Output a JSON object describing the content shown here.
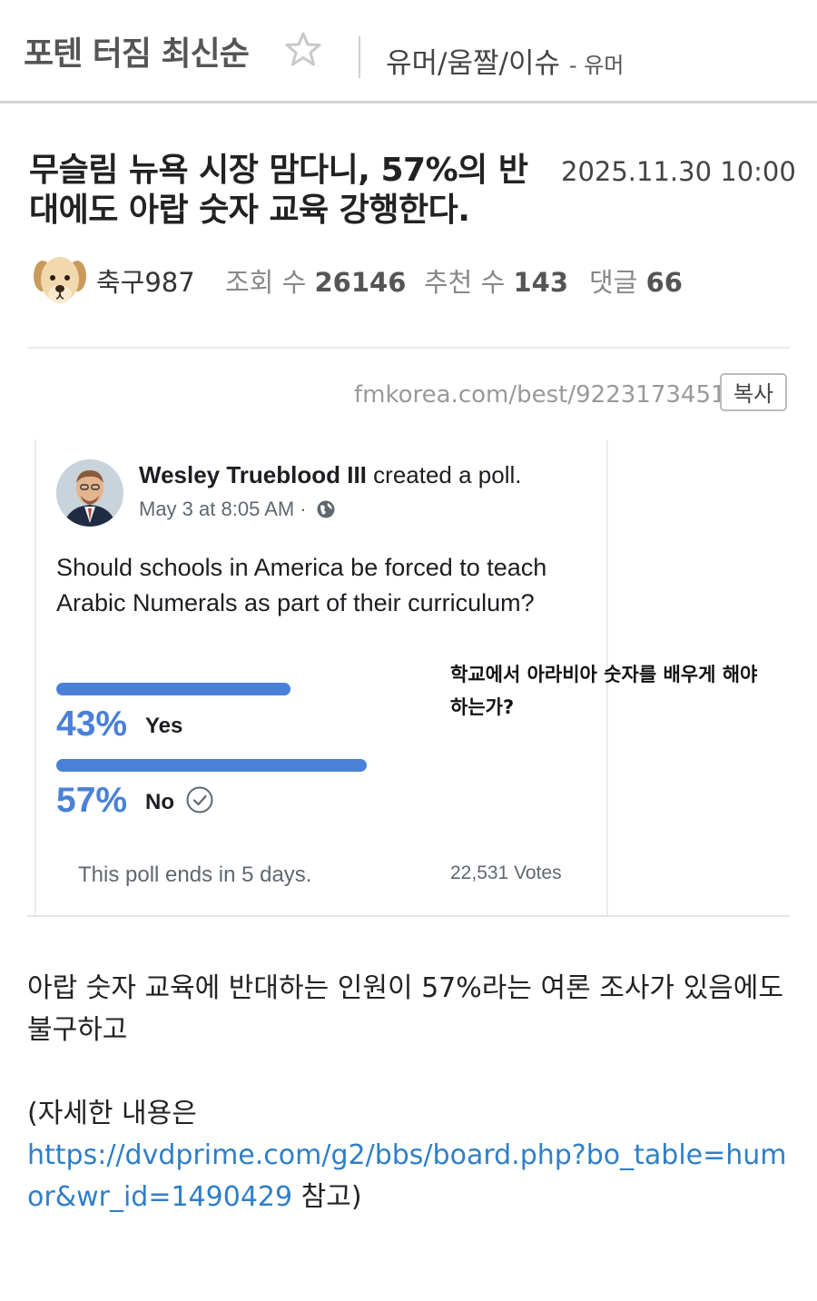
{
  "header": {
    "board_title": "포텐 터짐 최신순",
    "category": "유머/움짤/이슈",
    "sub_category": "- 유머"
  },
  "post": {
    "title": "무슬림 뉴욕 시장 맘다니, 57%의 반대에도 아랍 숫자 교육 강행한다.",
    "date": "2025.11.30 10:00",
    "author": "축구987",
    "views_label": "조회 수",
    "views": "26146",
    "recommend_label": "추천 수",
    "recommend": "143",
    "comments_label": "댓글",
    "comments": "66",
    "source_url": "fmkorea.com/best/9223173451",
    "copy_label": "복사"
  },
  "embedded_poll": {
    "poster_name": "Wesley Trueblood III",
    "action": "created a poll.",
    "time": "May 3 at 8:05 AM ·",
    "question": "Should schools in America be forced to teach Arabic Numerals as part of their curriculum?",
    "options": [
      {
        "percent": "43%",
        "label": "Yes",
        "share": 0.43
      },
      {
        "percent": "57%",
        "label": "No",
        "share": 0.57
      }
    ],
    "ends": "This poll ends in 5 days.",
    "votes": "22,531 Votes",
    "korean_overlay": "학교에서 아라비아 숫자를 배우게 해야 하는가?",
    "accent_color": "#4a80d8"
  },
  "body": {
    "paragraph1": "아랍 숫자 교육에 반대하는 인원이 57%라는 여론 조사가 있음에도 불구하고",
    "paragraph2_prefix": "(자세한 내용은",
    "link": "https://dvdprime.com/g2/bbs/board.php?bo_table=humor&wr_id=1490429",
    "paragraph2_suffix": " 참고)"
  },
  "icons": {
    "favorite": "star-outline-icon",
    "privacy": "globe-icon",
    "voted": "check-circle-icon"
  }
}
